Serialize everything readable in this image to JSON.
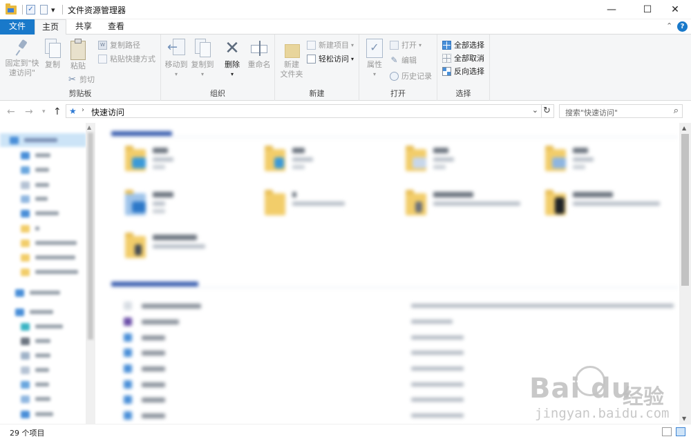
{
  "window": {
    "title": "文件资源管理器",
    "controls": {
      "minimize": "—",
      "maximize": "☐",
      "close": "✕"
    }
  },
  "quick_access_toolbar": {
    "dropdown": "▾"
  },
  "tabs": {
    "file": "文件",
    "home": "主页",
    "share": "共享",
    "view": "查看"
  },
  "ribbon": {
    "clipboard": {
      "group_label": "剪贴板",
      "pin_line1": "固定到\"快",
      "pin_line2": "速访问\"",
      "copy": "复制",
      "paste": "粘贴",
      "copy_path": "复制路径",
      "paste_shortcut": "粘贴快捷方式",
      "cut": "剪切"
    },
    "organize": {
      "group_label": "组织",
      "move_to": "移动到",
      "copy_to": "复制到",
      "delete": "删除",
      "rename": "重命名"
    },
    "new": {
      "group_label": "新建",
      "new_folder_line1": "新建",
      "new_folder_line2": "文件夹",
      "new_item": "新建项目",
      "easy_access": "轻松访问"
    },
    "open": {
      "group_label": "打开",
      "properties": "属性",
      "open": "打开",
      "edit": "编辑",
      "history": "历史记录"
    },
    "select": {
      "group_label": "选择",
      "select_all": "全部选择",
      "select_none": "全部取消",
      "invert": "反向选择"
    }
  },
  "address": {
    "path": "快速访问",
    "search_placeholder": "搜索\"快速访问\""
  },
  "status": {
    "item_count": "29 个项目"
  },
  "watermark": {
    "brand": "Bai du",
    "cn": "经验",
    "url": "jingyan.baidu.com"
  },
  "colors": {
    "accent": "#1979ca",
    "folder": "#f2cd6a",
    "selection": "#cce4f7"
  }
}
